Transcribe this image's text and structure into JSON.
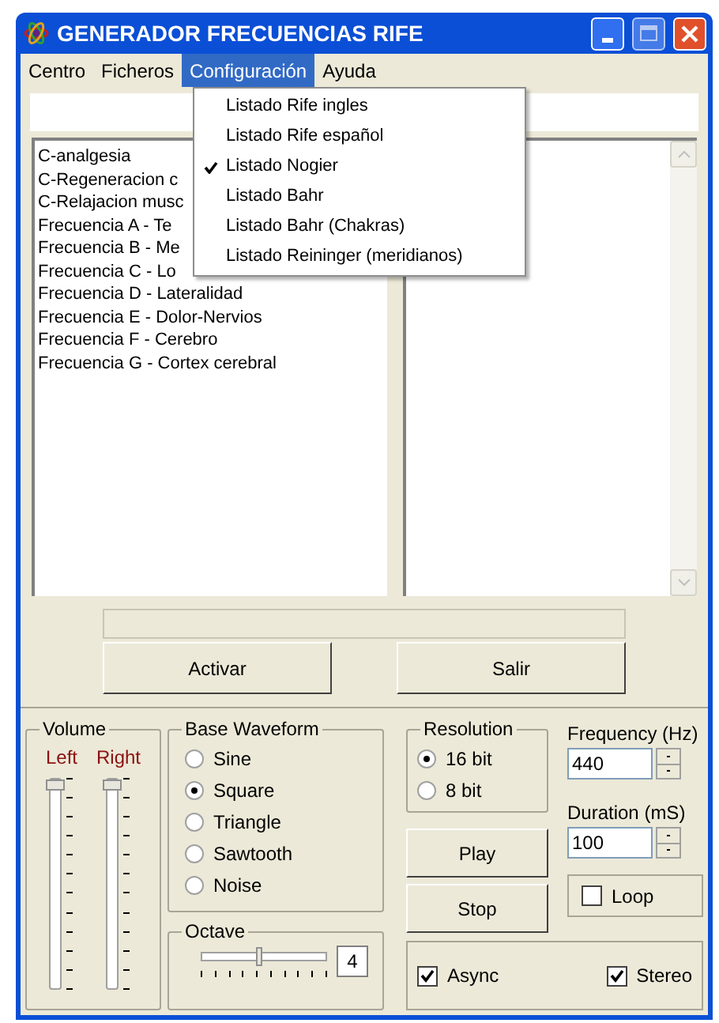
{
  "window": {
    "title": "GENERADOR FRECUENCIAS RIFE"
  },
  "menu_bar": [
    {
      "label": "Centro",
      "selected": false
    },
    {
      "label": "Ficheros",
      "selected": false
    },
    {
      "label": "Configuración",
      "selected": true
    },
    {
      "label": "Ayuda",
      "selected": false
    }
  ],
  "dropdown": [
    {
      "label": "Listado Rife ingles",
      "checked": false
    },
    {
      "label": "Listado Rife español",
      "checked": false
    },
    {
      "label": "Listado Nogier",
      "checked": true
    },
    {
      "label": "Listado Bahr",
      "checked": false
    },
    {
      "label": "Listado Bahr (Chakras)",
      "checked": false
    },
    {
      "label": "Listado Reininger (meridianos)",
      "checked": false
    }
  ],
  "list": [
    "C-analgesia",
    "C-Regeneracion c",
    "C-Relajacion musc",
    "Frecuencia A - Te",
    "Frecuencia B - Me",
    "Frecuencia C - Lo",
    "Frecuencia D - Lateralidad",
    "Frecuencia E - Dolor-Nervios",
    "Frecuencia F - Cerebro",
    "Frecuencia G - Cortex cerebral"
  ],
  "progress": {
    "level": 0
  },
  "buttons": [
    "Activar",
    "Salir"
  ],
  "volume": {
    "title": "Volume",
    "channels": [
      {
        "label": "Left",
        "level": 1
      },
      {
        "label": "Right",
        "level": 1
      }
    ]
  },
  "waveform": {
    "title": "Base Waveform",
    "options": [
      {
        "label": "Sine",
        "selected": false
      },
      {
        "label": "Square",
        "selected": true
      },
      {
        "label": "Triangle",
        "selected": false
      },
      {
        "label": "Sawtooth",
        "selected": false
      },
      {
        "label": "Noise",
        "selected": false
      }
    ]
  },
  "octave": {
    "title": "Octave",
    "level": 0.45,
    "value": "4"
  },
  "resolution": {
    "title": "Resolution",
    "options": [
      {
        "label": "16 bit",
        "selected": true
      },
      {
        "label": "8 bit",
        "selected": false
      }
    ]
  },
  "frequency": {
    "label": "Frequency (Hz)",
    "value": "440"
  },
  "duration": {
    "label": "Duration (mS)",
    "value": "100"
  },
  "play": "Play",
  "stop": "Stop",
  "loop": {
    "label": "Loop",
    "checked": false
  },
  "async": {
    "label": "Async",
    "checked": true
  },
  "stereo": {
    "label": "Stereo",
    "checked": true
  }
}
